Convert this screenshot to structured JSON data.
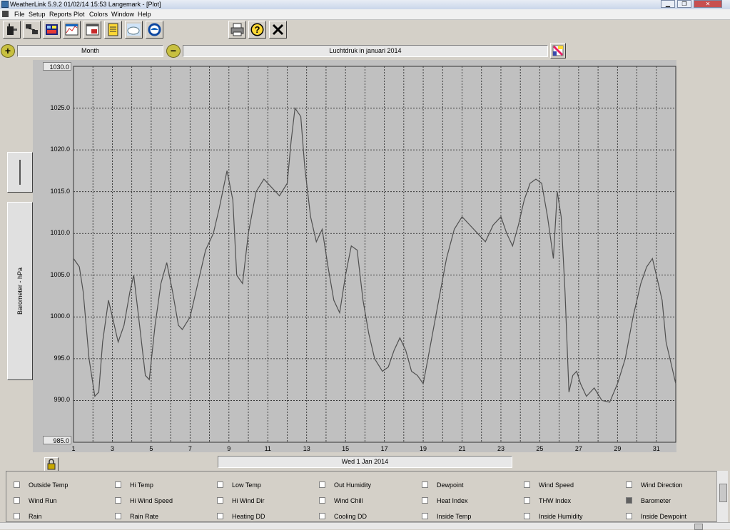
{
  "window": {
    "title": "WeatherLink 5.9.2  01/02/14  15:53  Langemark - [Plot]",
    "controls": [
      "minimize",
      "restore",
      "close"
    ]
  },
  "menu": [
    "File",
    "Setup",
    "Reports",
    "Plot",
    "Colors",
    "Window",
    "Help"
  ],
  "toolbar": {
    "left_icons": [
      "walkie-talkie-icon",
      "network-icon",
      "console-icon",
      "chart-icon",
      "window-icon",
      "notepad-icon",
      "noaa-cloud-icon",
      "noaa-seal-icon"
    ],
    "right_icons": [
      "printer-icon",
      "help-icon",
      "close-icon"
    ]
  },
  "controls": {
    "period": "Month",
    "plot_title": "Luchtdruk in januari 2014"
  },
  "axis": {
    "ylabel": "Barometer - hPa",
    "bottom_label": "Wed 1 Jan 2014"
  },
  "chart_data": {
    "type": "line",
    "ylim": [
      985.0,
      1030.0
    ],
    "xlim": [
      1,
      32
    ],
    "ytick_labels": [
      "1030.0",
      "1025.0",
      "1020.0",
      "1015.0",
      "1010.0",
      "1005.0",
      "1000.0",
      "995.0",
      "990.0",
      "985.0"
    ],
    "yticks": [
      1030,
      1025,
      1020,
      1015,
      1010,
      1005,
      1000,
      995,
      990,
      985
    ],
    "xticks": [
      1,
      3,
      5,
      7,
      9,
      11,
      13,
      15,
      17,
      19,
      21,
      23,
      25,
      27,
      29,
      31
    ],
    "grid": true,
    "series": [
      {
        "color": "#505050",
        "x": [
          1.0,
          1.3,
          1.5,
          1.8,
          2.1,
          2.3,
          2.5,
          2.8,
          3.0,
          3.3,
          3.6,
          3.9,
          4.1,
          4.4,
          4.7,
          4.9,
          5.2,
          5.5,
          5.8,
          6.1,
          6.4,
          6.6,
          7.0,
          7.4,
          7.8,
          8.2,
          8.5,
          8.9,
          9.2,
          9.4,
          9.7,
          10.0,
          10.4,
          10.8,
          11.2,
          11.6,
          12.0,
          12.2,
          12.4,
          12.7,
          12.9,
          13.2,
          13.5,
          13.8,
          14.1,
          14.4,
          14.7,
          15.0,
          15.3,
          15.6,
          15.9,
          16.2,
          16.5,
          16.9,
          17.2,
          17.5,
          17.8,
          18.1,
          18.4,
          18.7,
          19.0,
          19.4,
          19.8,
          20.2,
          20.6,
          21.0,
          21.4,
          21.8,
          22.2,
          22.6,
          23.0,
          23.3,
          23.6,
          23.9,
          24.2,
          24.5,
          24.8,
          25.1,
          25.4,
          25.7,
          25.9,
          26.1,
          26.3,
          26.5,
          26.7,
          26.9,
          27.1,
          27.4,
          27.8,
          28.2,
          28.6,
          29.0,
          29.4,
          29.8,
          30.2,
          30.5,
          30.8,
          31.0,
          31.3,
          31.5,
          31.8,
          32.0
        ],
        "y": [
          1007.0,
          1006.0,
          1003.0,
          995.0,
          990.5,
          991.0,
          997.0,
          1002.0,
          1000.0,
          997.0,
          999.0,
          1003.0,
          1005.0,
          999.0,
          993.0,
          992.5,
          999.0,
          1004.0,
          1006.5,
          1003.0,
          999.0,
          998.5,
          1000.0,
          1004.0,
          1008.0,
          1010.0,
          1013.0,
          1017.5,
          1014.0,
          1005.0,
          1004.0,
          1010.0,
          1015.0,
          1016.5,
          1015.5,
          1014.5,
          1016.0,
          1021.0,
          1025.0,
          1024.0,
          1018.0,
          1012.0,
          1009.0,
          1010.5,
          1006.0,
          1002.0,
          1000.5,
          1005.0,
          1008.5,
          1008.0,
          1002.0,
          998.0,
          995.0,
          993.5,
          994.0,
          996.0,
          997.5,
          996.0,
          993.5,
          993.0,
          992.0,
          997.0,
          1002.0,
          1007.0,
          1010.5,
          1012.0,
          1011.0,
          1010.0,
          1009.0,
          1011.0,
          1012.0,
          1010.0,
          1008.5,
          1011.0,
          1014.0,
          1016.0,
          1016.5,
          1016.0,
          1012.0,
          1007.0,
          1015.0,
          1012.0,
          1003.0,
          991.0,
          993.0,
          993.5,
          992.0,
          990.5,
          991.5,
          990.0,
          989.8,
          992.0,
          995.0,
          1000.0,
          1004.0,
          1006.0,
          1007.0,
          1005.0,
          1002.0,
          997.0,
          994.0,
          992.0
        ]
      }
    ]
  },
  "checkboxes": [
    {
      "label": "Outside Temp",
      "checked": false
    },
    {
      "label": "Hi Temp",
      "checked": false
    },
    {
      "label": "Low Temp",
      "checked": false
    },
    {
      "label": "Out Humidity",
      "checked": false
    },
    {
      "label": "Dewpoint",
      "checked": false
    },
    {
      "label": "Wind Speed",
      "checked": false
    },
    {
      "label": "Wind Direction",
      "checked": false
    },
    {
      "label": "Wind Run",
      "checked": false
    },
    {
      "label": "Hi Wind Speed",
      "checked": false
    },
    {
      "label": "Hi Wind Dir",
      "checked": false
    },
    {
      "label": "Wind Chill",
      "checked": false
    },
    {
      "label": "Heat Index",
      "checked": false
    },
    {
      "label": "THW Index",
      "checked": false
    },
    {
      "label": "Barometer",
      "checked": true
    },
    {
      "label": "Rain",
      "checked": false
    },
    {
      "label": "Rain Rate",
      "checked": false
    },
    {
      "label": "Heating DD",
      "checked": false
    },
    {
      "label": "Cooling DD",
      "checked": false
    },
    {
      "label": "Inside Temp",
      "checked": false
    },
    {
      "label": "Inside Humidity",
      "checked": false
    },
    {
      "label": "Inside Dewpoint",
      "checked": false
    }
  ]
}
